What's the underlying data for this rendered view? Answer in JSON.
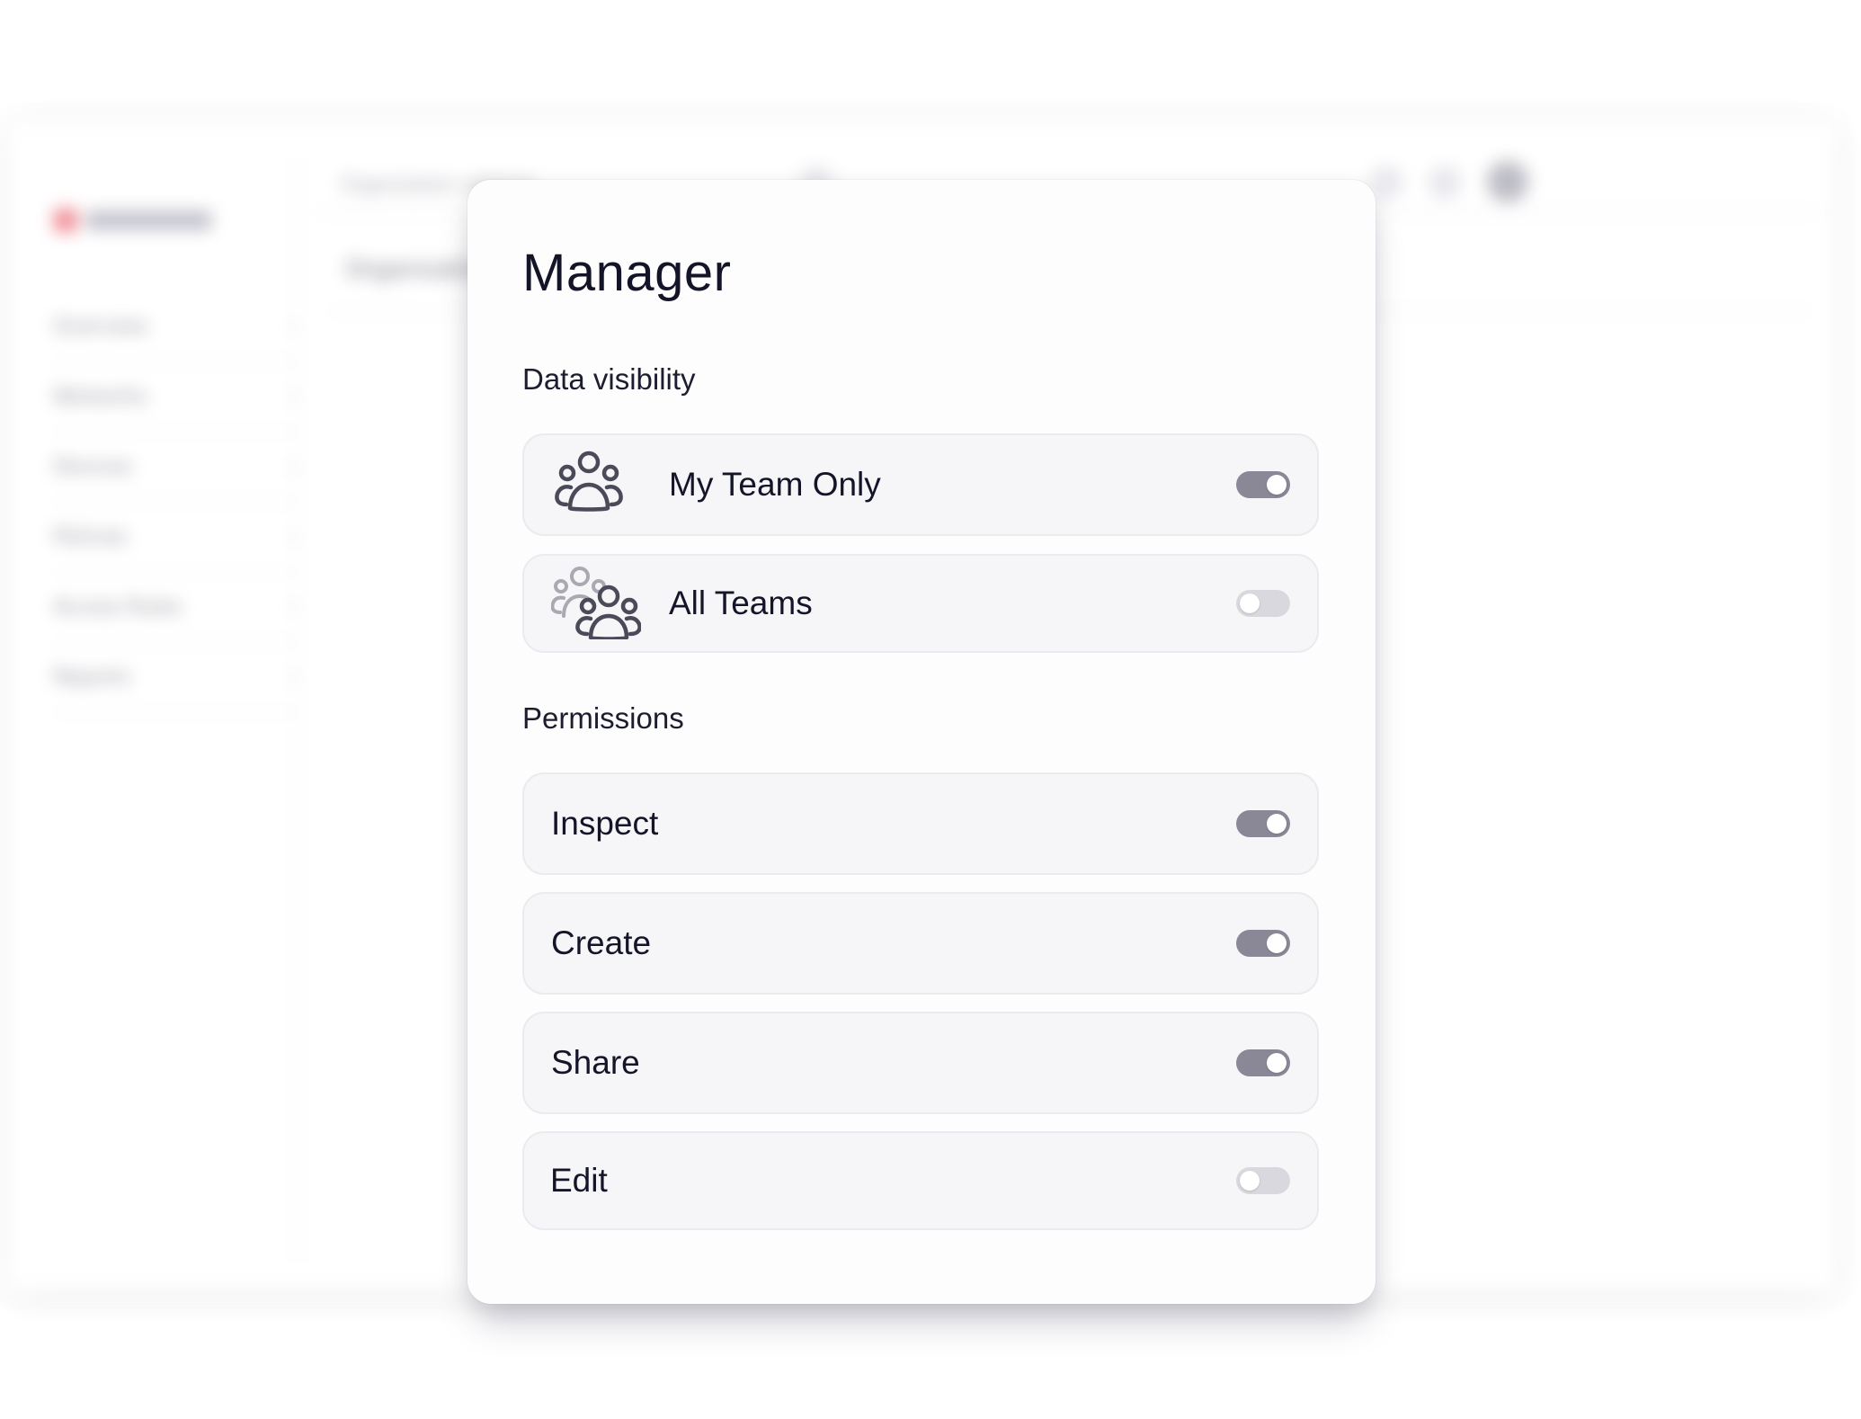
{
  "background": {
    "nav_items": [
      "Overview",
      "Networks",
      "Devices",
      "Policies",
      "Access Rules",
      "Reports"
    ],
    "crumb": "Organization settings",
    "content_title": "Organization"
  },
  "modal": {
    "title": "Manager",
    "data_visibility": {
      "label": "Data visibility",
      "options": [
        {
          "label": "My Team Only",
          "icon": "team-icon",
          "enabled": true
        },
        {
          "label": "All Teams",
          "icon": "all-teams-icon",
          "enabled": false
        }
      ]
    },
    "permissions": {
      "label": "Permissions",
      "items": [
        {
          "label": "Inspect",
          "enabled": true
        },
        {
          "label": "Create",
          "enabled": true
        },
        {
          "label": "Share",
          "enabled": true
        },
        {
          "label": "Edit",
          "enabled": false
        }
      ]
    }
  },
  "colors": {
    "toggle_on": "#8a8896",
    "toggle_off": "#d9d8de",
    "row_bg": "#f6f6f8",
    "text": "#15152a"
  }
}
